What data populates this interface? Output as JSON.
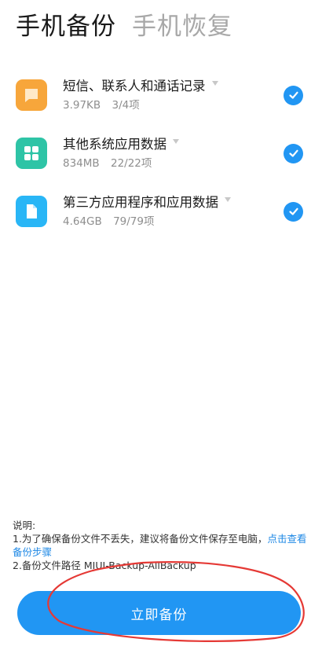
{
  "tabs": [
    {
      "label": "手机备份",
      "active": true
    },
    {
      "label": "手机恢复",
      "active": false
    }
  ],
  "items": [
    {
      "title": "短信、联系人和通话记录",
      "size": "3.97KB",
      "count": "3/4项",
      "icon": "message-icon",
      "icon_color": "#f7a63b",
      "checked": true
    },
    {
      "title": "其他系统应用数据",
      "size": "834MB",
      "count": "22/22项",
      "icon": "grid-icon",
      "icon_color": "#2ec4a6",
      "checked": true
    },
    {
      "title": "第三方应用程序和应用数据",
      "size": "4.64GB",
      "count": "79/79项",
      "icon": "document-icon",
      "icon_color": "#29b6f6",
      "checked": true
    }
  ],
  "notes": {
    "heading": "说明:",
    "line1_text": "1.为了确保备份文件不丢失，建议将备份文件保存至电脑，",
    "line1_link": "点击查看备份步骤",
    "line2": "2.备份文件路径 MIUI-Backup-AllBackup"
  },
  "backup_button": "立即备份",
  "colors": {
    "accent": "#2196f3",
    "annotation": "#e53935"
  }
}
